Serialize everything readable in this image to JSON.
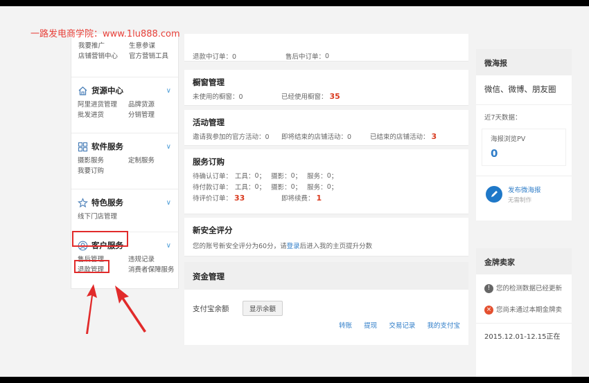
{
  "watermark": "一路发电商学院：www.1lu888.com",
  "sidebar": {
    "top_rows": [
      [
        "我要推广",
        "生意参谋"
      ],
      [
        "店铺营销中心",
        "官方营销工具"
      ]
    ],
    "sections": [
      {
        "title": "货源中心",
        "links": [
          [
            "阿里进货管理",
            "品牌货源"
          ],
          [
            "批发进货",
            "分销管理"
          ]
        ]
      },
      {
        "title": "软件服务",
        "links": [
          [
            "摄影服务",
            "定制服务"
          ],
          [
            "我要订购",
            ""
          ]
        ]
      },
      {
        "title": "特色服务",
        "links": [
          [
            "线下门店管理",
            ""
          ]
        ]
      },
      {
        "title": "客户服务",
        "links": [
          [
            "售后管理",
            "违规记录"
          ],
          [
            "退款管理",
            "消费者保障服务"
          ]
        ]
      }
    ]
  },
  "center": {
    "top_partial": {
      "refund_label": "退款中订单：",
      "refund_value": "0",
      "after_label": "售后中订单：",
      "after_value": "0"
    },
    "window": {
      "title": "橱窗管理",
      "unused_label": "未使用的橱窗：",
      "unused_value": "0",
      "used_label": "已经使用橱窗：",
      "used_value": "35"
    },
    "activity": {
      "title": "活动管理",
      "invited_label": "邀请我参加的官方活动：",
      "invited_value": "0",
      "ending_label": "即将结束的店铺活动：",
      "ending_value": "0",
      "ended_label": "已结束的店铺活动：",
      "ended_value": "3"
    },
    "service": {
      "title": "服务订购",
      "confirm_label": "待确认订单：",
      "pay_label": "待付款订单：",
      "tool": "工具：",
      "photo": "摄影：",
      "svc": "服务：",
      "zero": "0",
      "sep": "；",
      "review_label": "待评价订单：",
      "review_value": "33",
      "expiring_label": "即将续费：",
      "expiring_value": "1"
    },
    "security": {
      "title": "新安全评分",
      "text_before": "您的账号新安全评分为60分，请",
      "login_link": "登录",
      "text_after": "后进入我的主页提升分数"
    },
    "funds": {
      "title": "资金管理",
      "alipay_label": "支付宝余额",
      "show_button": "显示余额",
      "links": [
        "转账",
        "提现",
        "交易记录",
        "我的支付宝"
      ]
    }
  },
  "right": {
    "poster_title": "微海报",
    "poster_channels": "微信、微博、朋友圈",
    "recent": "近7天数据：",
    "pv_label": "海报浏览PV",
    "pv_value": "0",
    "publish_label": "发布微海报",
    "publish_sub": "无需制作",
    "gold_title": "金牌卖家",
    "notice1": "您的检测数据已经更新",
    "notice2": "您尚未通过本期金牌卖",
    "date_text": "2015.12.01-12.15正在"
  },
  "colors": {
    "accent_red": "#e12a2a",
    "number_red": "#d93a1f",
    "link_blue": "#2f7dc8",
    "chevron_blue": "#4a9bd6"
  }
}
